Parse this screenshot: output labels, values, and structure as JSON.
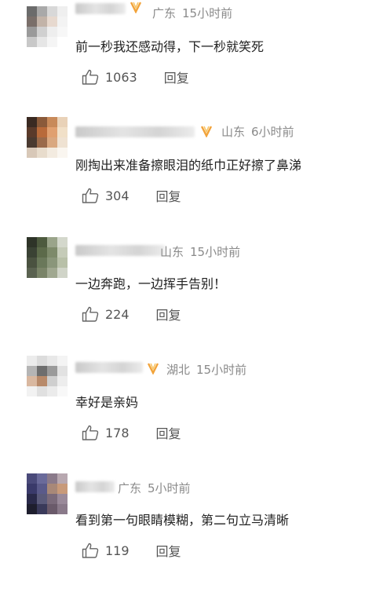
{
  "comments": [
    {
      "location": "广东",
      "time": "15小时前",
      "text": "前一秒我还感动得，下一秒就笑死",
      "likes": "1063",
      "reply": "回复",
      "avatar": [
        "#6b6b6b",
        "#a9a9a9",
        "#d8d8d8",
        "#efefef",
        "#7a6f6a",
        "#c2b3a8",
        "#e7d9cf",
        "#f3f3f3",
        "#9a9a9a",
        "#d0d0d0",
        "#eeeeee",
        "#f7f7f7",
        "#c8c8c8",
        "#e6e6e6",
        "#f5f5f5",
        "#ffffff"
      ]
    },
    {
      "location": "山东",
      "time": "6小时前",
      "text": "刚掏出来准备擦眼泪的纸巾正好擦了鼻涕",
      "likes": "304",
      "reply": "回复",
      "avatar": [
        "#3a2a22",
        "#8a5a3a",
        "#c88a5a",
        "#e9d2b8",
        "#5a3a2a",
        "#b86a3a",
        "#e0a070",
        "#f1e0c8",
        "#4a3a30",
        "#9a6a4a",
        "#d9a880",
        "#efe2d2",
        "#d8c8b8",
        "#e8dccc",
        "#f3ebe0",
        "#faf6f0"
      ]
    },
    {
      "location": "山东",
      "time": "15小时前",
      "text": "一边奔跑，一边挥手告别！",
      "likes": "224",
      "reply": "回复",
      "avatar": [
        "#2e3428",
        "#4d5a3e",
        "#9aa48a",
        "#d4d8cc",
        "#3a4234",
        "#5c6a4a",
        "#7d8a6a",
        "#c5cbb8",
        "#4a5240",
        "#6a785a",
        "#8a967a",
        "#b8c0a8",
        "#5a6250",
        "#7a8468",
        "#a0a890",
        "#d0d4c8"
      ]
    },
    {
      "location": "湖北",
      "time": "15小时前",
      "text": "幸好是亲妈",
      "likes": "178",
      "reply": "回复",
      "avatar": [
        "#ececec",
        "#dcdcdc",
        "#e8e8e8",
        "#f4f4f4",
        "#b5b5b5",
        "#6e6e6e",
        "#9a9a9a",
        "#e2e2e2",
        "#d9b8a0",
        "#b88a6a",
        "#cfcfcf",
        "#ededed",
        "#f2f2f2",
        "#e0e0e0",
        "#ebebeb",
        "#f8f8f8"
      ]
    },
    {
      "location": "广东",
      "time": "5小时前",
      "text": "看到第一句眼睛模糊，第二句立马清晰",
      "likes": "119",
      "reply": "回复",
      "avatar": [
        "#4a4a7a",
        "#6a6a9a",
        "#8a7a8a",
        "#b8a8b0",
        "#3a3a6a",
        "#5a5a8a",
        "#a88878",
        "#c89a7a",
        "#2a2a4a",
        "#5a5a7a",
        "#7a6a7a",
        "#9a8a9a",
        "#1e1e2e",
        "#3a3a5a",
        "#6a5a6a",
        "#8a7a8a"
      ]
    }
  ]
}
